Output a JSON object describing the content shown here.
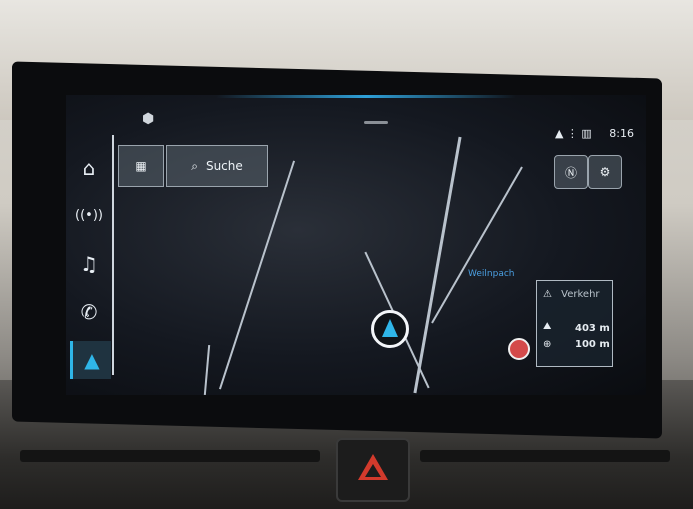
{
  "search": {
    "label": "Suche"
  },
  "city_label": "Weilnpach",
  "status": {
    "time": "8:16"
  },
  "traffic": {
    "title": "Verkehr",
    "dist1": "403 m",
    "dist2": "100 m"
  },
  "icons": [
    "home-icon",
    "radio-icon",
    "music-icon",
    "phone-icon",
    "navigation-icon",
    "grid-icon",
    "search-icon",
    "compass-icon",
    "settings-icon",
    "cube-icon"
  ]
}
